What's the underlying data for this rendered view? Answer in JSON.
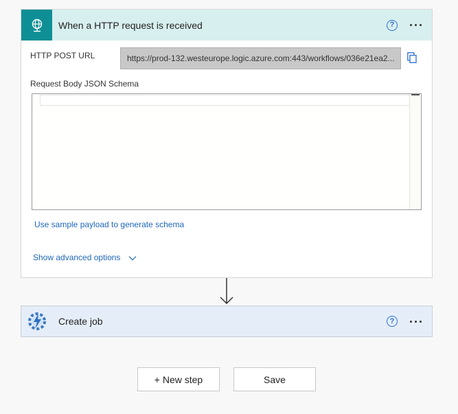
{
  "trigger": {
    "title": "When a HTTP request is received",
    "help": "?",
    "url_label": "HTTP POST URL",
    "url_value": "https://prod-132.westeurope.logic.azure.com:443/workflows/036e21ea2...",
    "schema_label": "Request Body JSON Schema",
    "schema_value": "",
    "sample_link": "Use sample payload to generate schema",
    "advanced_link": "Show advanced options",
    "accent_color": "#0e8f95"
  },
  "job": {
    "title": "Create job",
    "help": "?"
  },
  "footer": {
    "new_step_label": "+ New step",
    "save_label": "Save"
  }
}
